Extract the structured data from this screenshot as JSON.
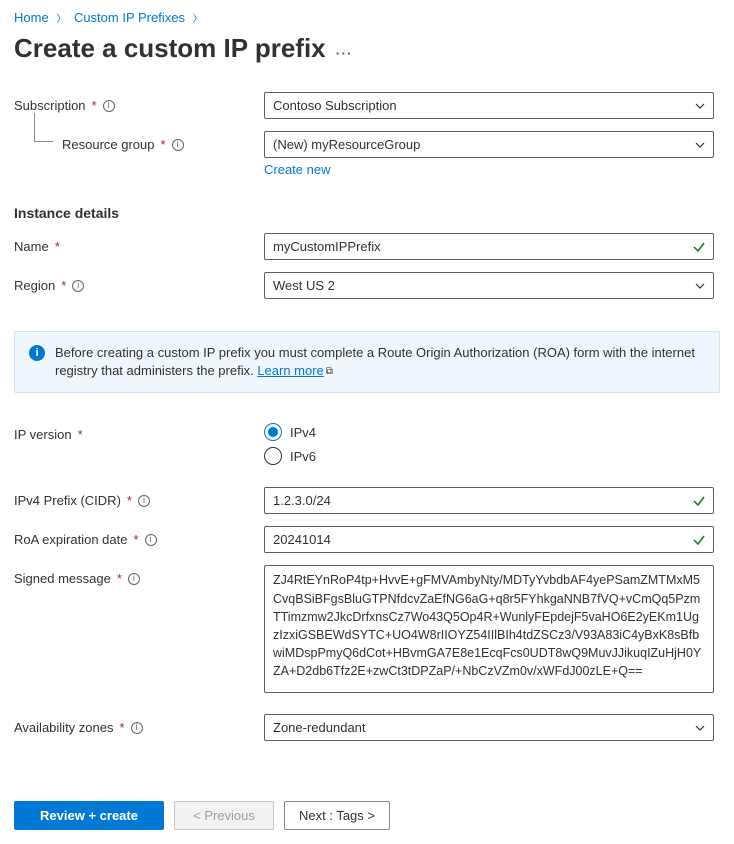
{
  "breadcrumbs": {
    "home": "Home",
    "prefixes": "Custom IP Prefixes"
  },
  "title": "Create a custom IP prefix",
  "labels": {
    "subscription": "Subscription",
    "resource_group": "Resource group",
    "create_new": "Create new",
    "instance_details": "Instance details",
    "name": "Name",
    "region": "Region",
    "ip_version": "IP version",
    "ipv4_prefix": "IPv4 Prefix (CIDR)",
    "roa_expiration": "RoA expiration date",
    "signed_message": "Signed message",
    "availability_zones": "Availability zones"
  },
  "values": {
    "subscription": "Contoso Subscription",
    "resource_group": "(New) myResourceGroup",
    "name": "myCustomIPPrefix",
    "region": "West US 2",
    "ip_version_options": {
      "ipv4": "IPv4",
      "ipv6": "IPv6"
    },
    "ip_version_selected": "ipv4",
    "ipv4_prefix": "1.2.3.0/24",
    "roa_expiration": "20241014",
    "signed_message": "ZJ4RtEYnRoP4tp+HvvE+gFMVAmbyNty/MDTyYvbdbAF4yePSamZMTMxM5CvqBSiBFgsBluGTPNfdcvZaEfNG6aG+q8r5FYhkgaNNB7fVQ+vCmQq5PzmTTimzmw2JkcDrfxnsCz7Wo43Q5Op4R+WunlyFEpdejF5vaHO6E2yEKm1UgzIzxiGSBEWdSYTC+UO4W8rIIOYZ54IIlBIh4tdZSCz3/V93A83iC4yBxK8sBfbwiMDspPmyQ6dCot+HBvmGA7E8e1EcqFcs0UDT8wQ9MuvJJikuqIZuHjH0YZA+D2db6Tfz2E+zwCt3tDPZaP/+NbCzVZm0v/xWFdJ00zLE+Q==",
    "availability_zones": "Zone-redundant"
  },
  "info": {
    "text_pre": "Before creating a custom IP prefix you must complete a Route Origin Authorization (ROA) form with the internet registry that administers the prefix. ",
    "learn_more": "Learn more"
  },
  "footer": {
    "review": "Review + create",
    "previous": "<  Previous",
    "next": "Next : Tags >"
  }
}
